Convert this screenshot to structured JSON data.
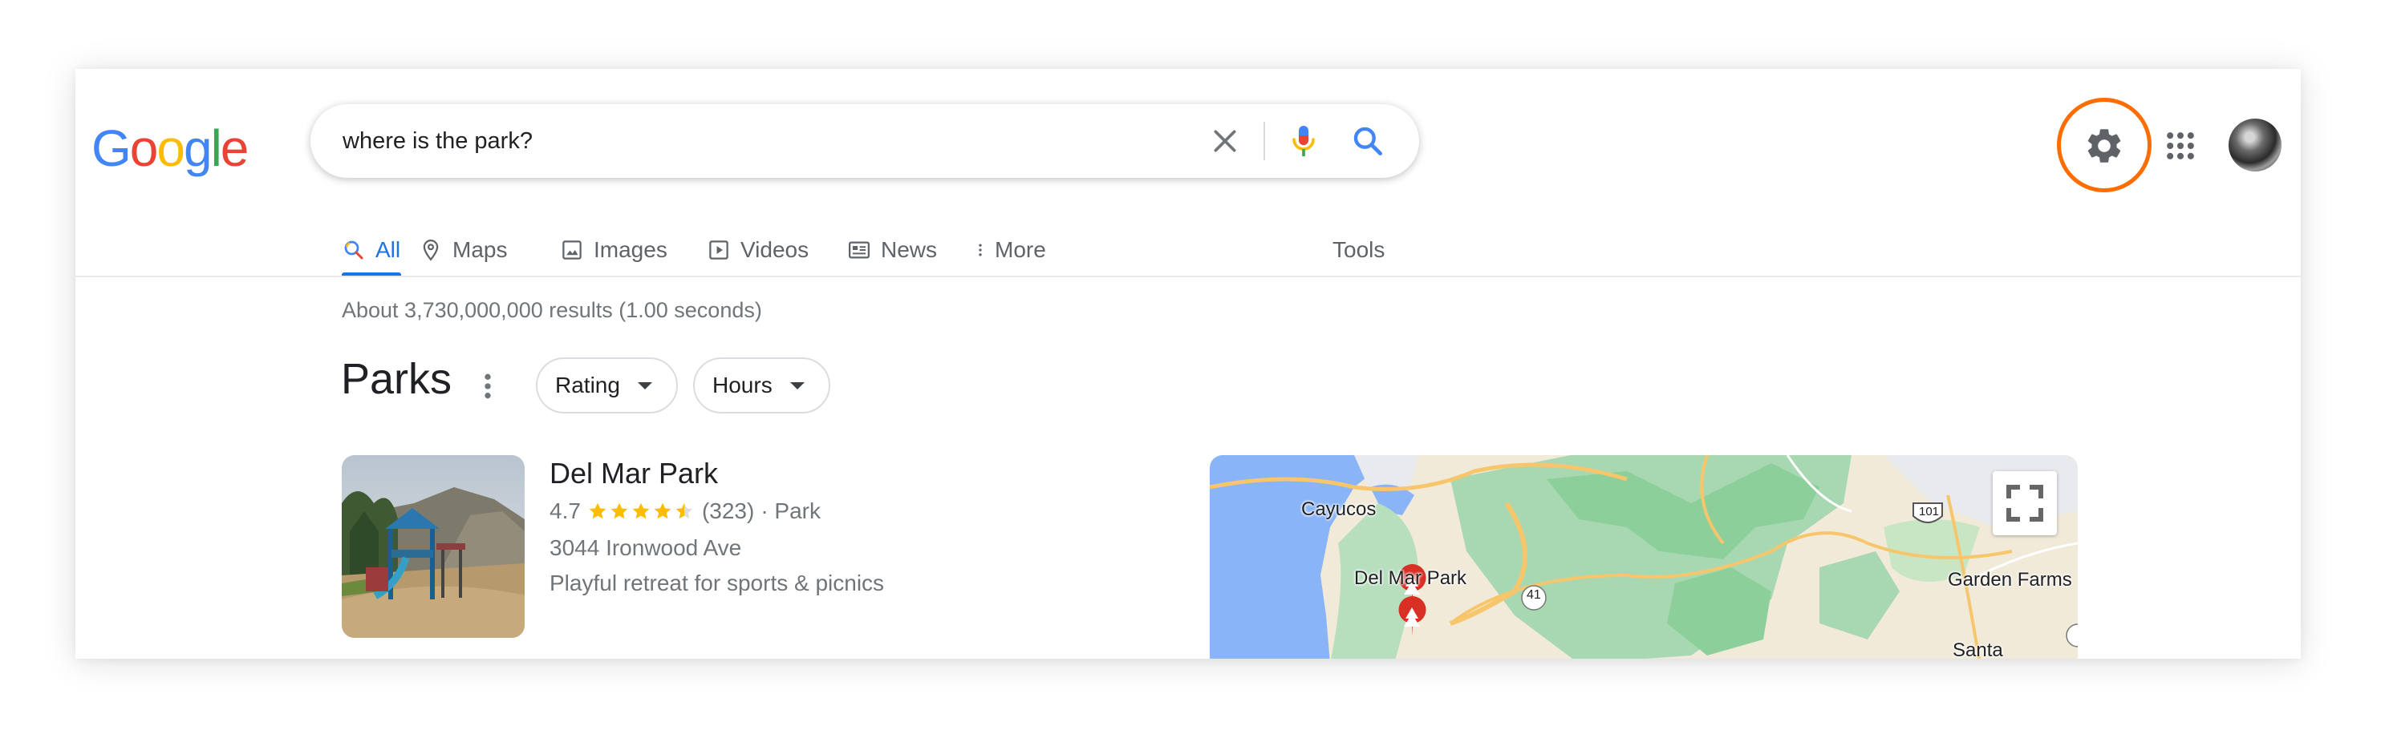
{
  "header": {
    "logo": {
      "letters": [
        "G",
        "o",
        "o",
        "g",
        "l",
        "e"
      ],
      "colors": [
        "#4285F4",
        "#EA4335",
        "#FBBC05",
        "#4285F4",
        "#34A853",
        "#EA4335"
      ]
    },
    "search": {
      "query": "where is the park?"
    },
    "icons": {
      "clear": "close-icon",
      "voice": "mic-icon",
      "search": "search-icon",
      "settings": "gear-icon",
      "apps": "apps-grid-icon"
    },
    "settings_highlight_color": "#ff6d00"
  },
  "tabs": [
    {
      "label": "All",
      "icon": "search-icon",
      "active": true
    },
    {
      "label": "Maps",
      "icon": "map-pin-icon"
    },
    {
      "label": "Images",
      "icon": "image-icon"
    },
    {
      "label": "Videos",
      "icon": "video-icon"
    },
    {
      "label": "News",
      "icon": "news-icon"
    },
    {
      "label": "More",
      "icon": "kebab-icon"
    }
  ],
  "tools_label": "Tools",
  "result_stats": "About 3,730,000,000 results (1.00 seconds)",
  "local_pack": {
    "title": "Parks",
    "filters": [
      {
        "label": "Rating"
      },
      {
        "label": "Hours"
      }
    ],
    "results": [
      {
        "name": "Del Mar Park",
        "rating": "4.7",
        "stars": 4.5,
        "reviews": "(323)",
        "category": "· Park",
        "address": "3044 Ironwood Ave",
        "description": "Playful retreat for sports & picnics"
      }
    ]
  },
  "map": {
    "labels": {
      "cayucos": "Cayucos",
      "del_mar": "Del Mar Park",
      "garden_farms": "Garden Farms",
      "santa": "Santa",
      "hwy41": "41",
      "hwy101": "101"
    }
  }
}
